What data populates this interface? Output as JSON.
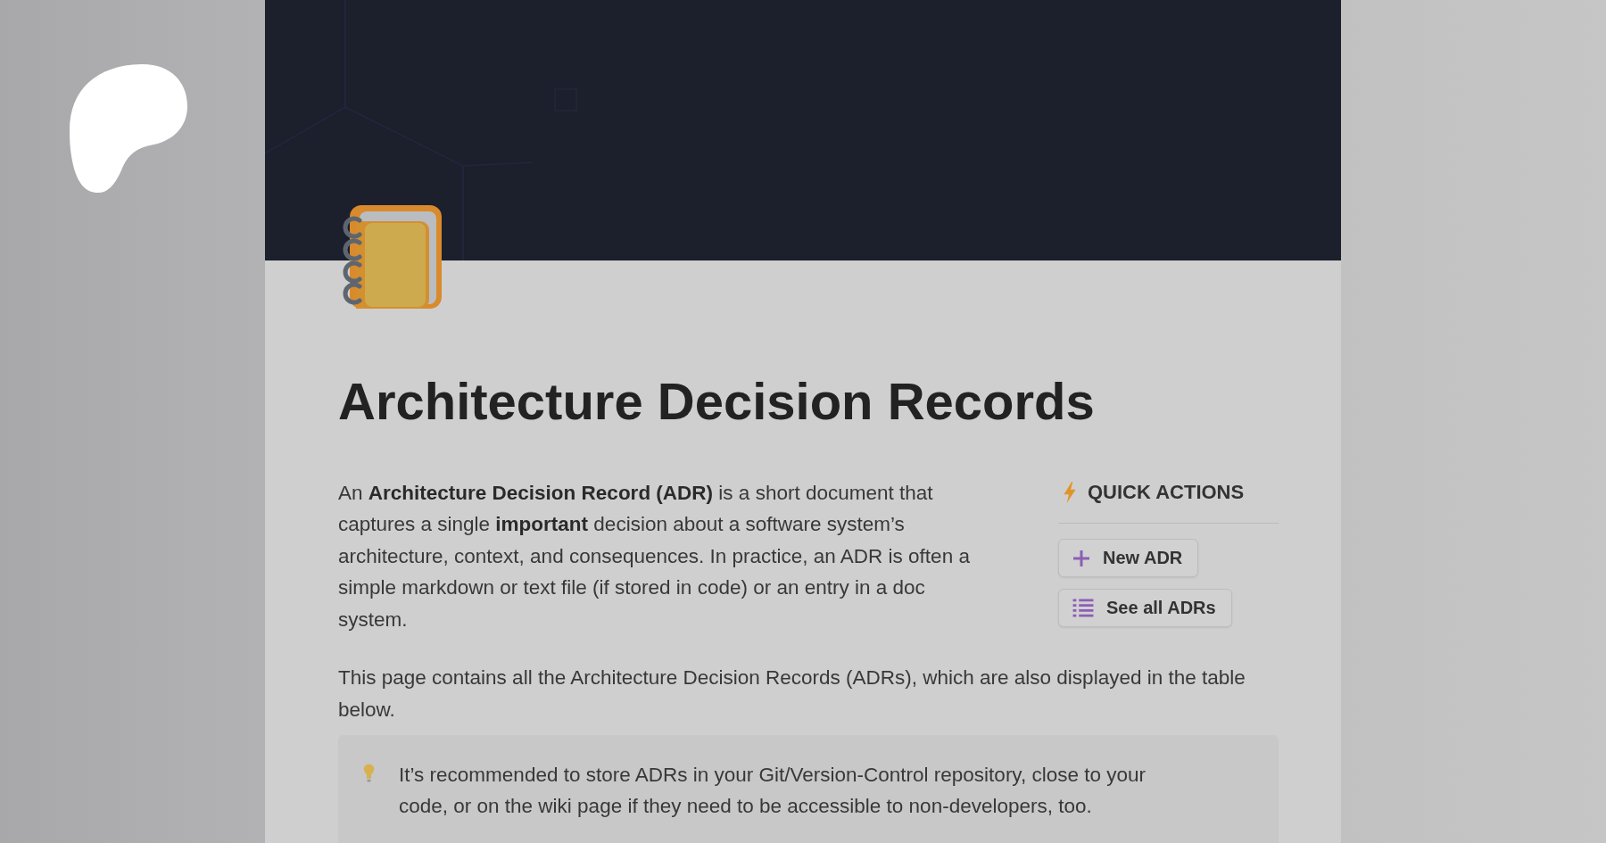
{
  "document": {
    "title": "Architecture Decision Records",
    "intro": "An **Architecture Decision Record (ADR)** is a short document that captures a single **important** decision about a software system’s architecture, context, and consequences. In practice, an ADR is often a simple markdown or text file (if stored in code) or an entry in a doc system.",
    "quick_actions": {
      "title": "QUICK ACTIONS",
      "buttons": [
        {
          "label": "New ADR",
          "kind": "add"
        },
        {
          "label": "See all ADRs",
          "kind": "list"
        }
      ]
    },
    "description": "This page contains all the Architecture Decision Records (ADRs), which are also displayed in the table below.",
    "callout": {
      "text": "It’s recommended to store ADRs in your Git/Version-Control repository, close to your code, or on the wiki page if they need to be accessible to non-developers, too."
    }
  }
}
